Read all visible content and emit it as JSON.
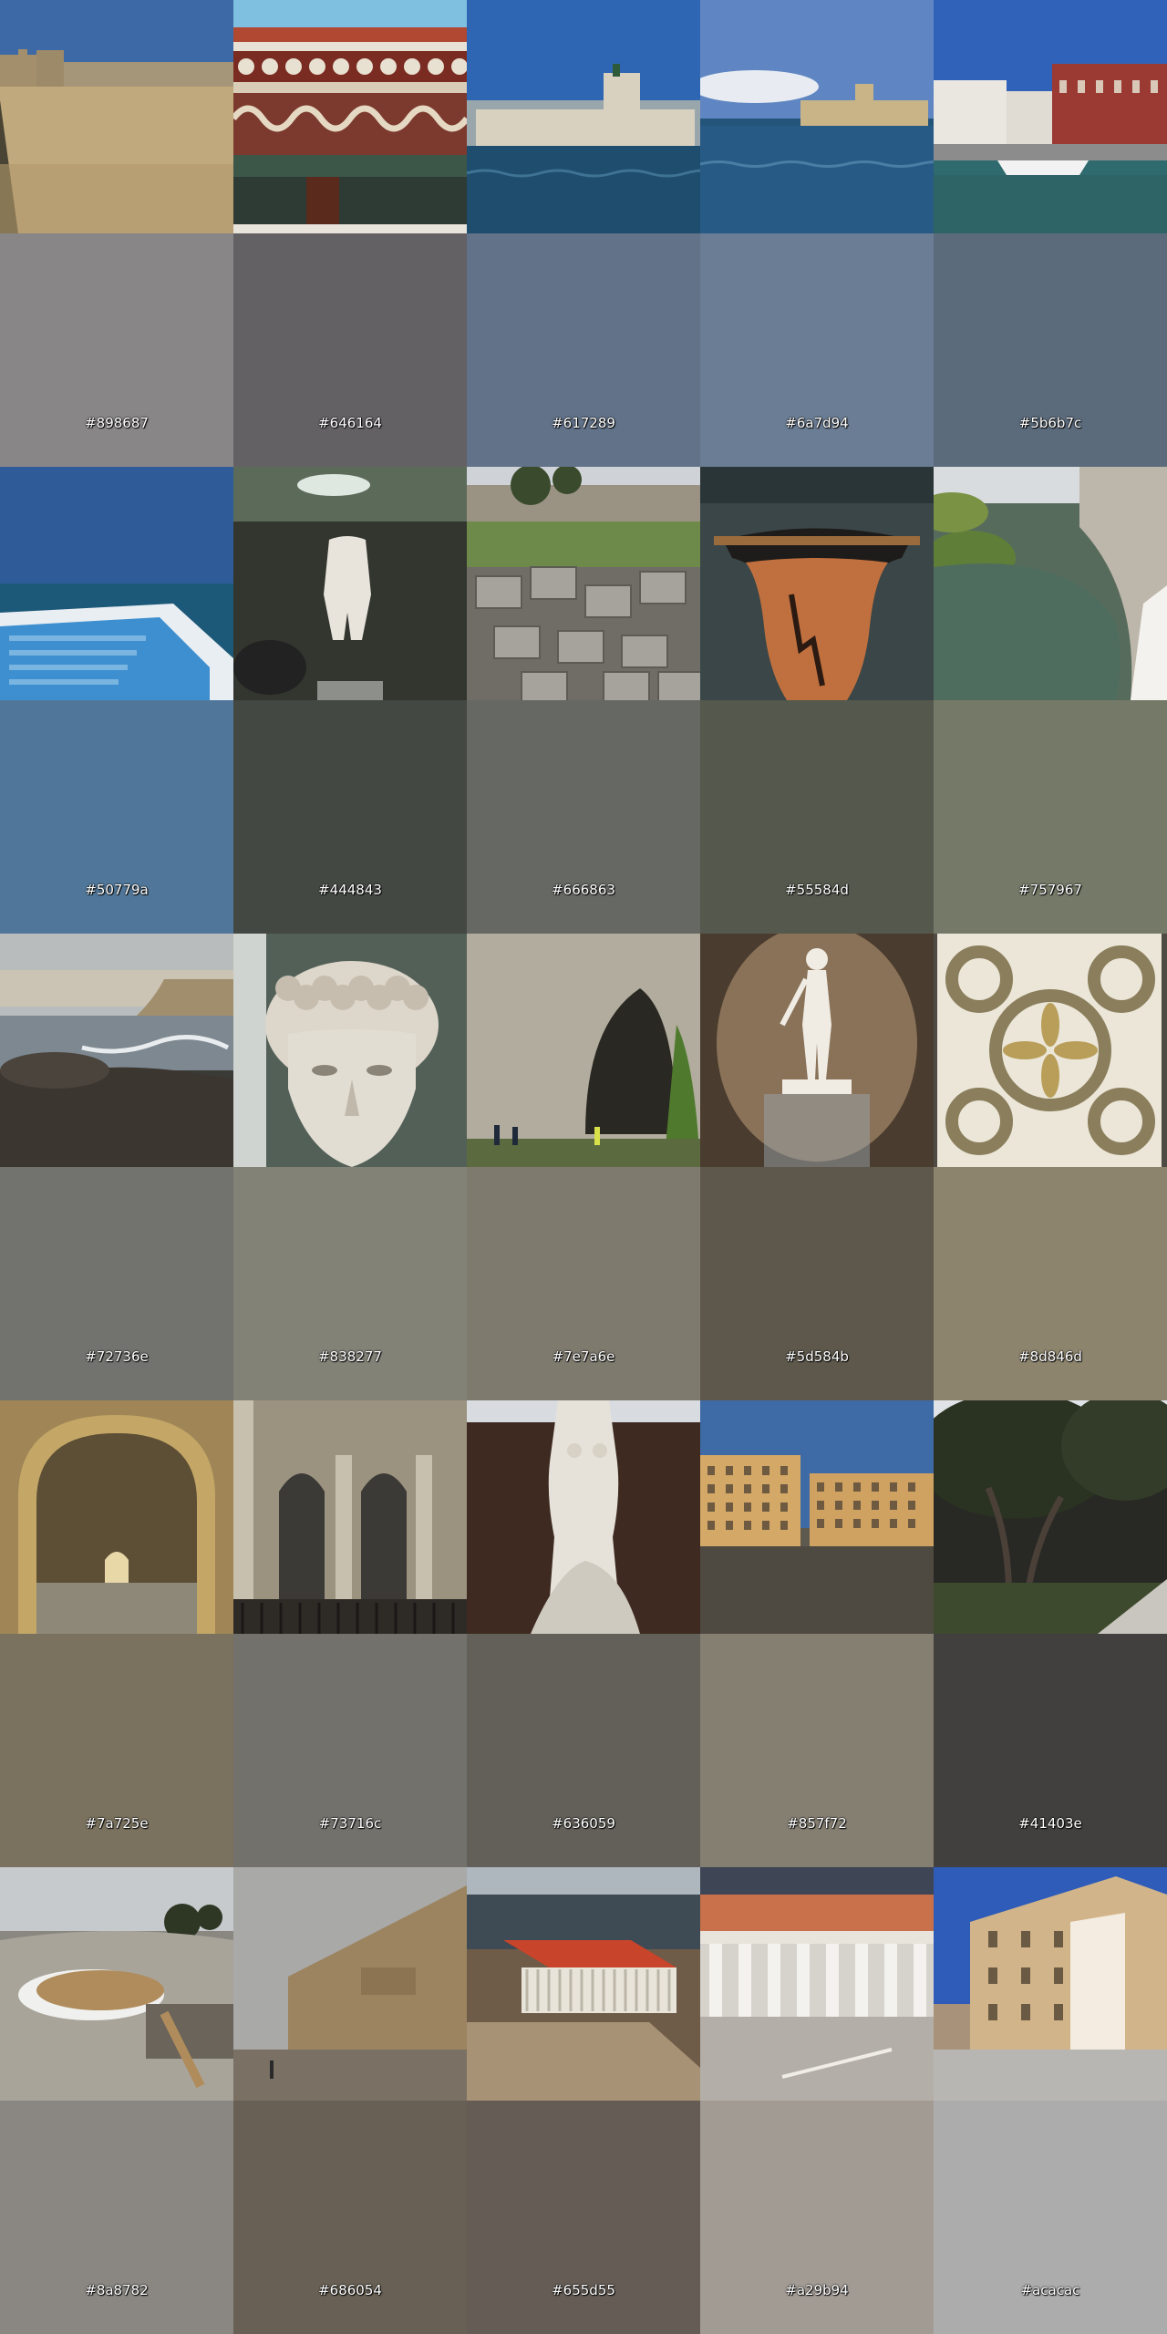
{
  "tiles": [
    {
      "scene": "fortress-wall-field",
      "icon": "fortress-photo",
      "hex": "#898687"
    },
    {
      "scene": "decorated-frieze",
      "icon": "frieze-photo",
      "hex": "#646164"
    },
    {
      "scene": "castle-on-sea",
      "icon": "sea-castle-photo",
      "hex": "#617289"
    },
    {
      "scene": "distant-castle-sea",
      "icon": "distant-castle-photo",
      "hex": "#6a7d94"
    },
    {
      "scene": "harbor-buildings",
      "icon": "harbor-photo",
      "hex": "#5b6b7c"
    },
    {
      "scene": "blue-boat",
      "icon": "boat-photo",
      "hex": "#50779a"
    },
    {
      "scene": "kouros-statue",
      "icon": "statue-photo",
      "hex": "#444843"
    },
    {
      "scene": "stone-ruins",
      "icon": "ruins-photo",
      "hex": "#666863"
    },
    {
      "scene": "greek-vase",
      "icon": "vase-photo",
      "hex": "#55584d"
    },
    {
      "scene": "spring-pool",
      "icon": "pool-photo",
      "hex": "#757967"
    },
    {
      "scene": "rocky-coast",
      "icon": "coast-photo",
      "hex": "#72736e"
    },
    {
      "scene": "marble-head",
      "icon": "head-photo",
      "hex": "#838277"
    },
    {
      "scene": "cave-cliff",
      "icon": "cave-photo",
      "hex": "#7e7a6e"
    },
    {
      "scene": "standing-statue",
      "icon": "statue-photo",
      "hex": "#5d584b"
    },
    {
      "scene": "mosaic-floor",
      "icon": "mosaic-photo",
      "hex": "#8d846d"
    },
    {
      "scene": "stone-arch",
      "icon": "arch-photo",
      "hex": "#7a725e"
    },
    {
      "scene": "cathedral-interior",
      "icon": "cathedral-photo",
      "hex": "#73716c"
    },
    {
      "scene": "venus-statue",
      "icon": "venus-statue-photo",
      "hex": "#636059"
    },
    {
      "scene": "piazza-buildings",
      "icon": "piazza-photo",
      "hex": "#857f72"
    },
    {
      "scene": "ficus-trees",
      "icon": "trees-photo",
      "hex": "#41403e"
    },
    {
      "scene": "greek-theater",
      "icon": "theater-photo",
      "hex": "#8a8782"
    },
    {
      "scene": "church-wall",
      "icon": "church-wall-photo",
      "hex": "#686054"
    },
    {
      "scene": "temple-model",
      "icon": "temple-model-photo",
      "hex": "#655d55"
    },
    {
      "scene": "temple-colonnade",
      "icon": "colonnade-photo",
      "hex": "#a29b94"
    },
    {
      "scene": "street-palazzo",
      "icon": "palazzo-photo",
      "hex": "#acacac"
    }
  ]
}
